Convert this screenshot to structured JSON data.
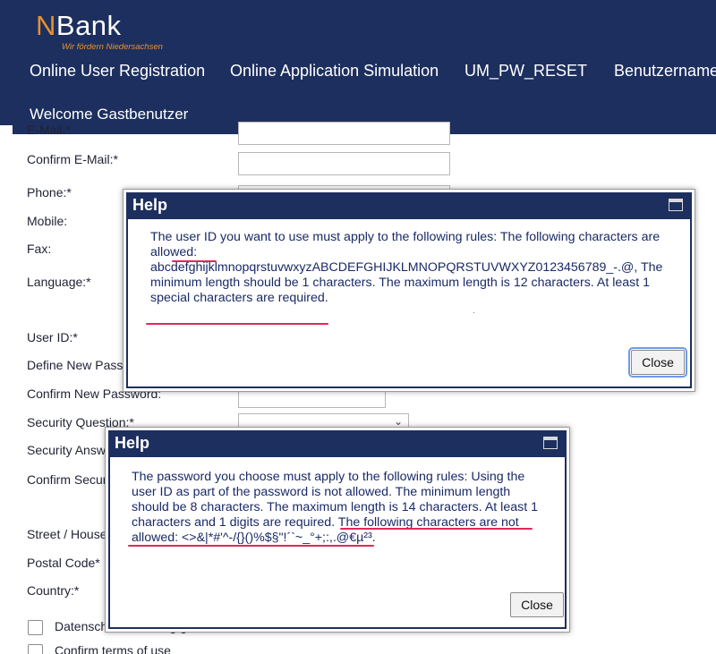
{
  "header": {
    "logo_text": "NBank",
    "logo_tagline": "Wir fördern Niedersachsen",
    "nav": [
      "Online User Registration",
      "Online Application Simulation",
      "UM_PW_RESET",
      "Benutzername"
    ],
    "welcome": "Welcome Gastbenutzer"
  },
  "form": {
    "labels": {
      "email": "E-Mail:*",
      "confirm_email": "Confirm E-Mail:*",
      "phone": "Phone:*",
      "mobile": "Mobile:",
      "fax": "Fax:",
      "language": "Language:*",
      "user_id": "User ID:*",
      "define_password": "Define New Password:*",
      "confirm_password": "Confirm New Password:",
      "security_question": "Security Question:*",
      "security_answer": "Security Answer:*",
      "confirm_security": "Confirm Security Answer:*",
      "street": "Street  /  House No.:*",
      "postal_code": "Postal Code*",
      "country": "Country:*"
    },
    "checkboxes": {
      "privacy": "Datenschutzerklärung gelesen",
      "terms": "Confirm terms of use"
    }
  },
  "dialog_user_id": {
    "title": "Help",
    "lines": [
      "The user ID you want to use must apply to the following rules: The following characters are",
      "allowed:",
      "abcdefghijklmnopqrstuvwxyzABCDEFGHIJKLMNOPQRSTUVWXYZ0123456789_-.@, The",
      "minimum length should be 1 characters. The maximum length is 12 characters. At least 1",
      "special characters are required."
    ],
    "dot": ".",
    "close_label": "Close"
  },
  "dialog_password": {
    "title": "Help",
    "lines": [
      "The password you choose must apply to the following rules: Using the",
      "user ID as part of the password is not allowed. The minimum length",
      "should be 8 characters. The maximum length is 14 characters. At least 1",
      "characters and 1 digits are required. The following characters are not",
      "allowed: <>&|*#'^-/{}()%$§\"!´`~_°+;:,.@€µ²³."
    ],
    "close_label": "Close"
  },
  "colors": {
    "navy": "#1d2f5e",
    "brand_orange": "#e8912c",
    "annotation_red": "#e0285a",
    "help_text": "#1a2a66"
  },
  "icons": {
    "maximize": "maximize-icon",
    "select_chevron": "chevron-down-icon"
  }
}
